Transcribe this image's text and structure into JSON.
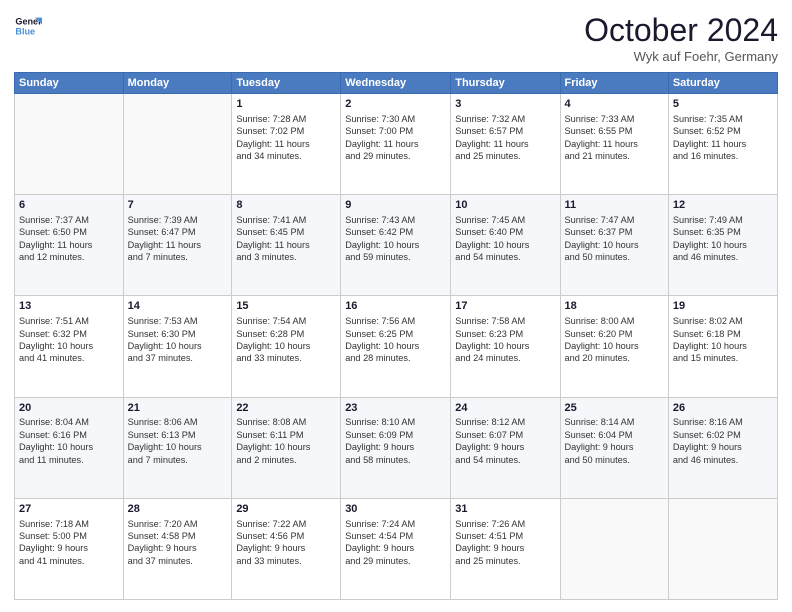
{
  "logo": {
    "line1": "General",
    "line2": "Blue"
  },
  "header": {
    "month": "October 2024",
    "location": "Wyk auf Foehr, Germany"
  },
  "weekdays": [
    "Sunday",
    "Monday",
    "Tuesday",
    "Wednesday",
    "Thursday",
    "Friday",
    "Saturday"
  ],
  "weeks": [
    [
      {
        "day": "",
        "info": ""
      },
      {
        "day": "",
        "info": ""
      },
      {
        "day": "1",
        "info": "Sunrise: 7:28 AM\nSunset: 7:02 PM\nDaylight: 11 hours\nand 34 minutes."
      },
      {
        "day": "2",
        "info": "Sunrise: 7:30 AM\nSunset: 7:00 PM\nDaylight: 11 hours\nand 29 minutes."
      },
      {
        "day": "3",
        "info": "Sunrise: 7:32 AM\nSunset: 6:57 PM\nDaylight: 11 hours\nand 25 minutes."
      },
      {
        "day": "4",
        "info": "Sunrise: 7:33 AM\nSunset: 6:55 PM\nDaylight: 11 hours\nand 21 minutes."
      },
      {
        "day": "5",
        "info": "Sunrise: 7:35 AM\nSunset: 6:52 PM\nDaylight: 11 hours\nand 16 minutes."
      }
    ],
    [
      {
        "day": "6",
        "info": "Sunrise: 7:37 AM\nSunset: 6:50 PM\nDaylight: 11 hours\nand 12 minutes."
      },
      {
        "day": "7",
        "info": "Sunrise: 7:39 AM\nSunset: 6:47 PM\nDaylight: 11 hours\nand 7 minutes."
      },
      {
        "day": "8",
        "info": "Sunrise: 7:41 AM\nSunset: 6:45 PM\nDaylight: 11 hours\nand 3 minutes."
      },
      {
        "day": "9",
        "info": "Sunrise: 7:43 AM\nSunset: 6:42 PM\nDaylight: 10 hours\nand 59 minutes."
      },
      {
        "day": "10",
        "info": "Sunrise: 7:45 AM\nSunset: 6:40 PM\nDaylight: 10 hours\nand 54 minutes."
      },
      {
        "day": "11",
        "info": "Sunrise: 7:47 AM\nSunset: 6:37 PM\nDaylight: 10 hours\nand 50 minutes."
      },
      {
        "day": "12",
        "info": "Sunrise: 7:49 AM\nSunset: 6:35 PM\nDaylight: 10 hours\nand 46 minutes."
      }
    ],
    [
      {
        "day": "13",
        "info": "Sunrise: 7:51 AM\nSunset: 6:32 PM\nDaylight: 10 hours\nand 41 minutes."
      },
      {
        "day": "14",
        "info": "Sunrise: 7:53 AM\nSunset: 6:30 PM\nDaylight: 10 hours\nand 37 minutes."
      },
      {
        "day": "15",
        "info": "Sunrise: 7:54 AM\nSunset: 6:28 PM\nDaylight: 10 hours\nand 33 minutes."
      },
      {
        "day": "16",
        "info": "Sunrise: 7:56 AM\nSunset: 6:25 PM\nDaylight: 10 hours\nand 28 minutes."
      },
      {
        "day": "17",
        "info": "Sunrise: 7:58 AM\nSunset: 6:23 PM\nDaylight: 10 hours\nand 24 minutes."
      },
      {
        "day": "18",
        "info": "Sunrise: 8:00 AM\nSunset: 6:20 PM\nDaylight: 10 hours\nand 20 minutes."
      },
      {
        "day": "19",
        "info": "Sunrise: 8:02 AM\nSunset: 6:18 PM\nDaylight: 10 hours\nand 15 minutes."
      }
    ],
    [
      {
        "day": "20",
        "info": "Sunrise: 8:04 AM\nSunset: 6:16 PM\nDaylight: 10 hours\nand 11 minutes."
      },
      {
        "day": "21",
        "info": "Sunrise: 8:06 AM\nSunset: 6:13 PM\nDaylight: 10 hours\nand 7 minutes."
      },
      {
        "day": "22",
        "info": "Sunrise: 8:08 AM\nSunset: 6:11 PM\nDaylight: 10 hours\nand 2 minutes."
      },
      {
        "day": "23",
        "info": "Sunrise: 8:10 AM\nSunset: 6:09 PM\nDaylight: 9 hours\nand 58 minutes."
      },
      {
        "day": "24",
        "info": "Sunrise: 8:12 AM\nSunset: 6:07 PM\nDaylight: 9 hours\nand 54 minutes."
      },
      {
        "day": "25",
        "info": "Sunrise: 8:14 AM\nSunset: 6:04 PM\nDaylight: 9 hours\nand 50 minutes."
      },
      {
        "day": "26",
        "info": "Sunrise: 8:16 AM\nSunset: 6:02 PM\nDaylight: 9 hours\nand 46 minutes."
      }
    ],
    [
      {
        "day": "27",
        "info": "Sunrise: 7:18 AM\nSunset: 5:00 PM\nDaylight: 9 hours\nand 41 minutes."
      },
      {
        "day": "28",
        "info": "Sunrise: 7:20 AM\nSunset: 4:58 PM\nDaylight: 9 hours\nand 37 minutes."
      },
      {
        "day": "29",
        "info": "Sunrise: 7:22 AM\nSunset: 4:56 PM\nDaylight: 9 hours\nand 33 minutes."
      },
      {
        "day": "30",
        "info": "Sunrise: 7:24 AM\nSunset: 4:54 PM\nDaylight: 9 hours\nand 29 minutes."
      },
      {
        "day": "31",
        "info": "Sunrise: 7:26 AM\nSunset: 4:51 PM\nDaylight: 9 hours\nand 25 minutes."
      },
      {
        "day": "",
        "info": ""
      },
      {
        "day": "",
        "info": ""
      }
    ]
  ]
}
